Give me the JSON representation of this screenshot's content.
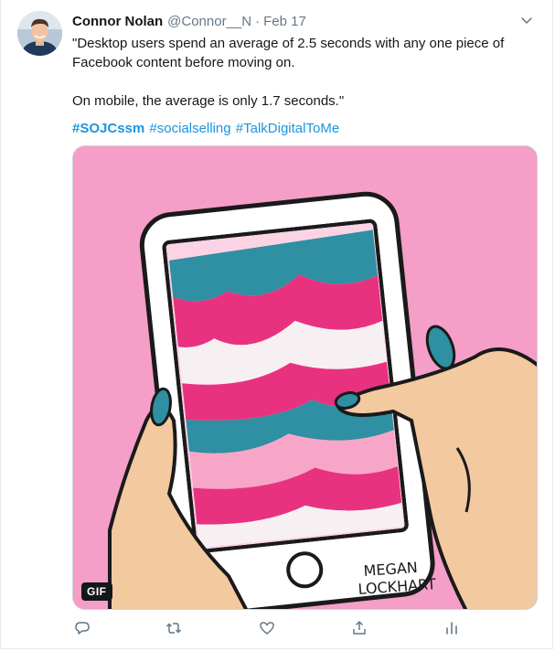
{
  "tweet": {
    "author_name": "Connor Nolan",
    "author_handle": "@Connor__N",
    "separator": "·",
    "date": "Feb 17",
    "text_line1": "\"Desktop users spend an average of 2.5 seconds with any one piece of Facebook content before moving on.",
    "text_line2": "On mobile, the average is only 1.7 seconds.\"",
    "hashtags": [
      "#SOJCssm",
      "#socialselling",
      "#TalkDigitalToMe"
    ],
    "media": {
      "badge": "GIF",
      "artist_signature": "MEGAN LOCKHART"
    }
  },
  "icons": {
    "reply": "reply-icon",
    "retweet": "retweet-icon",
    "like": "heart-icon",
    "share": "share-icon",
    "analytics": "analytics-icon",
    "more": "chevron-down-icon"
  },
  "colors": {
    "link": "#1b95e0",
    "secondary": "#657786",
    "media_background": "#f49ec8",
    "teal": "#2f8fa3",
    "magenta": "#e8327f",
    "skin": "#f3c9a0"
  }
}
